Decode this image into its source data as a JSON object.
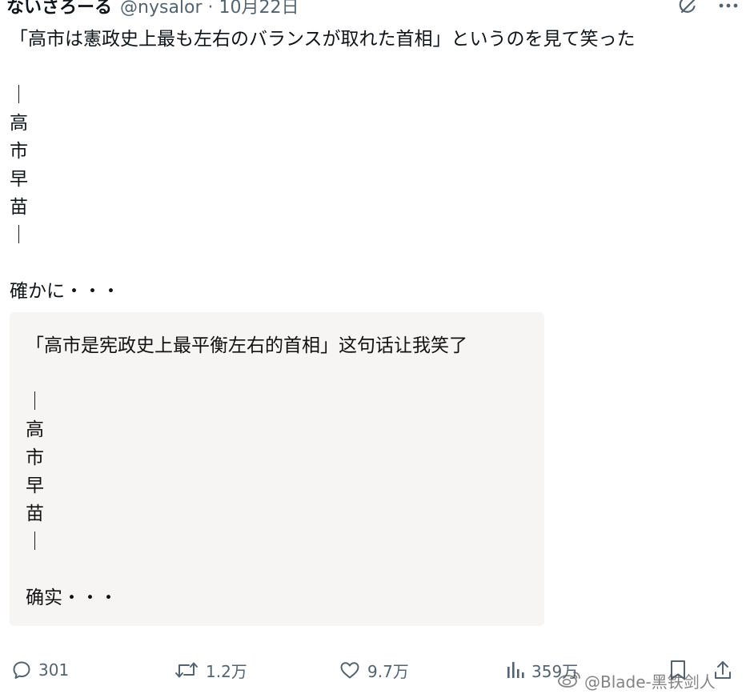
{
  "header": {
    "display_name": "ないさろーる",
    "handle": "@nysalor",
    "separator": "·",
    "date": "10月22日"
  },
  "tweet": {
    "lines": [
      "「高市は憲政史上最も左右のバランスが取れた首相」というのを見て笑った",
      "",
      "｜",
      "高",
      "市",
      "早",
      "苗",
      "｜",
      "",
      "確かに・・・"
    ]
  },
  "translation_card": {
    "lines": [
      "「高市是宪政史上最平衡左右的首相」这句话让我笑了",
      "",
      "｜",
      "高",
      "市",
      "早",
      "苗",
      "｜",
      "",
      "确实・・・"
    ]
  },
  "actions": {
    "reply_count": "301",
    "repost_count": "1.2万",
    "like_count": "9.7万",
    "views_count": "359万"
  },
  "watermark": {
    "text": "@Blade-黑铁剑人"
  },
  "icons": {
    "grok": "grok-icon",
    "more": "more-icon",
    "reply": "reply-icon",
    "repost": "repost-icon",
    "like": "heart-icon",
    "views": "views-icon",
    "bookmark": "bookmark-icon",
    "share": "share-icon",
    "weibo": "weibo-icon"
  },
  "colors": {
    "text": "#0f1419",
    "secondary": "#536471",
    "card_background": "#f7f4f4"
  }
}
